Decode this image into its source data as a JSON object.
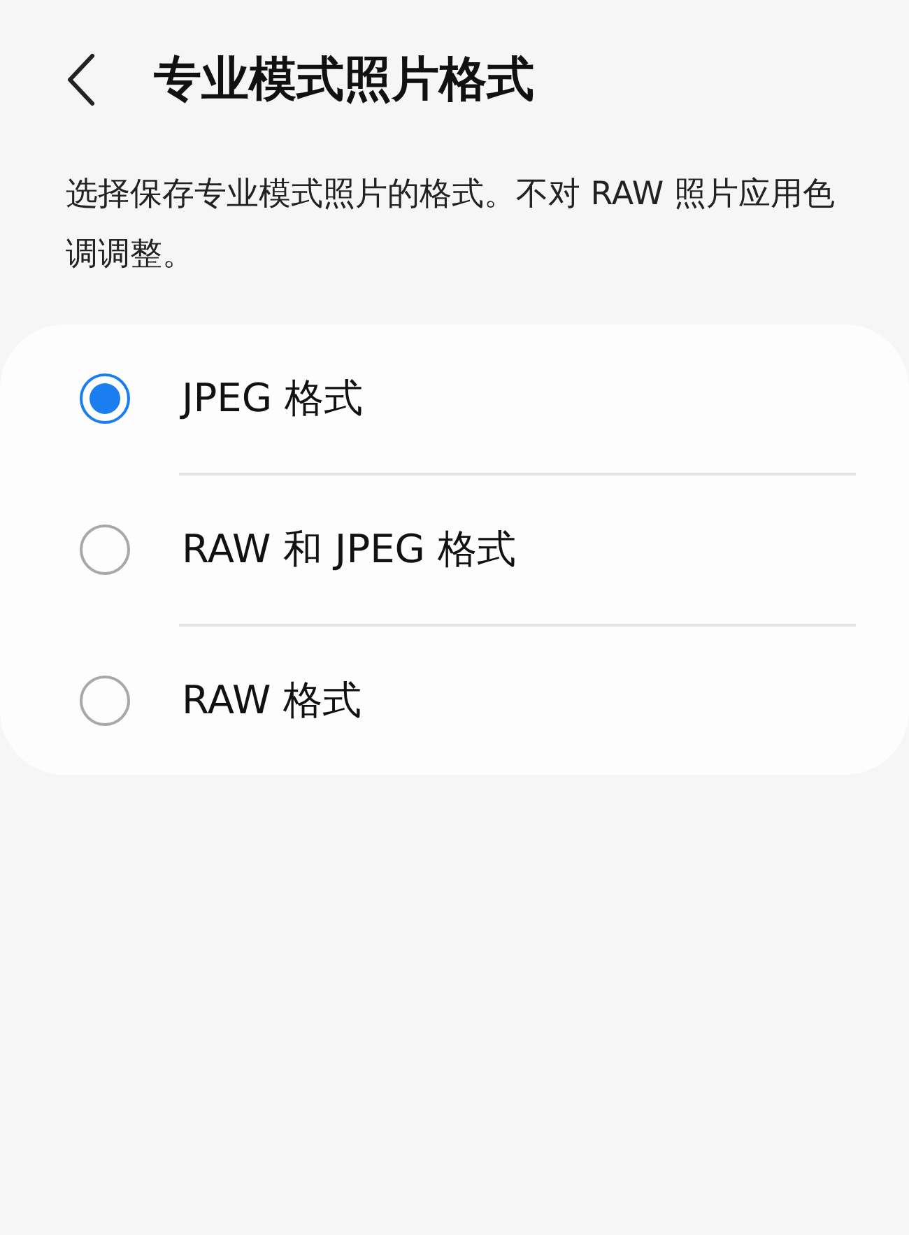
{
  "header": {
    "title": "专业模式照片格式"
  },
  "description": "选择保存专业模式照片的格式。不对 RAW 照片应用色调调整。",
  "options": [
    {
      "label": "JPEG 格式",
      "selected": true
    },
    {
      "label": "RAW 和 JPEG 格式",
      "selected": false
    },
    {
      "label": "RAW 格式",
      "selected": false
    }
  ]
}
